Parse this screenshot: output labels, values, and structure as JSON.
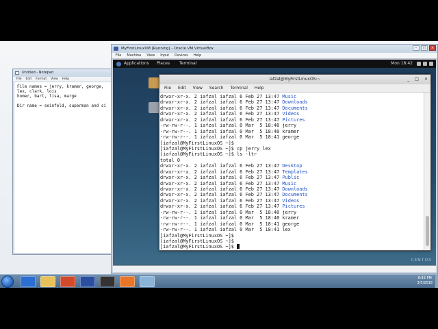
{
  "notepad": {
    "title": "Untitled - Notepad",
    "menu": [
      "File",
      "Edit",
      "Format",
      "View",
      "Help"
    ],
    "text": "File names = jerry, kramer, george,\nlex, clark, lois\nhomer, bart, lisa, marge\n\nDir name = seinfeld, superman and si"
  },
  "vbox": {
    "title": "MyFirstLinuxVM [Running] - Oracle VM VirtualBox",
    "menu": [
      "File",
      "Machine",
      "View",
      "Input",
      "Devices",
      "Help"
    ]
  },
  "guest": {
    "topbar": {
      "applications": "Applications",
      "places": "Places",
      "terminal": "Terminal",
      "clock": "Mon 18:42"
    },
    "desktop_brand": "CENTOS"
  },
  "terminal": {
    "title": "iafzal@MyFirstLinuxOS:~",
    "menu": [
      "File",
      "Edit",
      "View",
      "Search",
      "Terminal",
      "Help"
    ],
    "lines": [
      {
        "text": "drwxr-xr-x. 2 iafzal iafzal 6 Feb 27 13:47 ",
        "name": "Music"
      },
      {
        "text": "drwxr-xr-x. 2 iafzal iafzal 6 Feb 27 13:47 ",
        "name": "Downloads"
      },
      {
        "text": "drwxr-xr-x. 2 iafzal iafzal 6 Feb 27 13:47 ",
        "name": "Documents"
      },
      {
        "text": "drwxr-xr-x. 2 iafzal iafzal 6 Feb 27 13:47 ",
        "name": "Videos"
      },
      {
        "text": "drwxr-xr-x. 2 iafzal iafzal 6 Feb 27 13:47 ",
        "name": "Pictures"
      },
      {
        "text": "-rw-rw-r--. 1 iafzal iafzal 0 Mar  5 18:40 jerry",
        "name": ""
      },
      {
        "text": "-rw-rw-r--. 1 iafzal iafzal 0 Mar  5 18:40 kramer",
        "name": ""
      },
      {
        "text": "-rw-rw-r--. 1 iafzal iafzal 0 Mar  5 18:41 george",
        "name": ""
      },
      {
        "text": "[iafzal@MyFirstLinuxOS ~]$",
        "name": ""
      },
      {
        "text": "[iafzal@MyFirstLinuxOS ~]$ cp jerry lex",
        "name": ""
      },
      {
        "text": "[iafzal@MyFirstLinuxOS ~]$ ls -ltr",
        "name": ""
      },
      {
        "text": "total 0",
        "name": ""
      },
      {
        "text": "drwxr-xr-x. 2 iafzal iafzal 6 Feb 27 13:47 ",
        "name": "Desktop"
      },
      {
        "text": "drwxr-xr-x. 2 iafzal iafzal 6 Feb 27 13:47 ",
        "name": "Templates"
      },
      {
        "text": "drwxr-xr-x. 2 iafzal iafzal 6 Feb 27 13:47 ",
        "name": "Public"
      },
      {
        "text": "drwxr-xr-x. 2 iafzal iafzal 6 Feb 27 13:47 ",
        "name": "Music"
      },
      {
        "text": "drwxr-xr-x. 2 iafzal iafzal 6 Feb 27 13:47 ",
        "name": "Downloads"
      },
      {
        "text": "drwxr-xr-x. 2 iafzal iafzal 6 Feb 27 13:47 ",
        "name": "Documents"
      },
      {
        "text": "drwxr-xr-x. 2 iafzal iafzal 6 Feb 27 13:47 ",
        "name": "Videos"
      },
      {
        "text": "drwxr-xr-x. 2 iafzal iafzal 6 Feb 27 13:47 ",
        "name": "Pictures"
      },
      {
        "text": "-rw-rw-r--. 1 iafzal iafzal 0 Mar  5 18:40 jerry",
        "name": ""
      },
      {
        "text": "-rw-rw-r--. 1 iafzal iafzal 0 Mar  5 18:40 kramer",
        "name": ""
      },
      {
        "text": "-rw-rw-r--. 1 iafzal iafzal 0 Mar  5 18:41 george",
        "name": ""
      },
      {
        "text": "-rw-rw-r--. 1 iafzal iafzal 0 Mar  5 18:41 lex",
        "name": ""
      },
      {
        "text": "[iafzal@MyFirstLinuxOS ~]$",
        "name": ""
      },
      {
        "text": "[iafzal@MyFirstLinuxOS ~]$",
        "name": ""
      },
      {
        "text": "[iafzal@MyFirstLinuxOS ~]$ ",
        "name": "",
        "cursor": true
      }
    ],
    "dir_color": "#1d4fc7"
  },
  "taskbar": {
    "apps": [
      {
        "icon": "outlook-icon",
        "color": "#2a6fd1"
      },
      {
        "icon": "file-explorer-icon",
        "color": "#e8c15a"
      },
      {
        "icon": "powerpoint-icon",
        "color": "#d04a2b"
      },
      {
        "icon": "virtualbox-icon",
        "color": "#2a4f9e"
      },
      {
        "icon": "obs-icon",
        "color": "#333333"
      },
      {
        "icon": "firefox-icon",
        "color": "#e8772a"
      },
      {
        "icon": "notepad-icon",
        "color": "#8ab4d8"
      }
    ],
    "clock_time": "6:42 PM",
    "clock_date": "3/5/2018"
  }
}
